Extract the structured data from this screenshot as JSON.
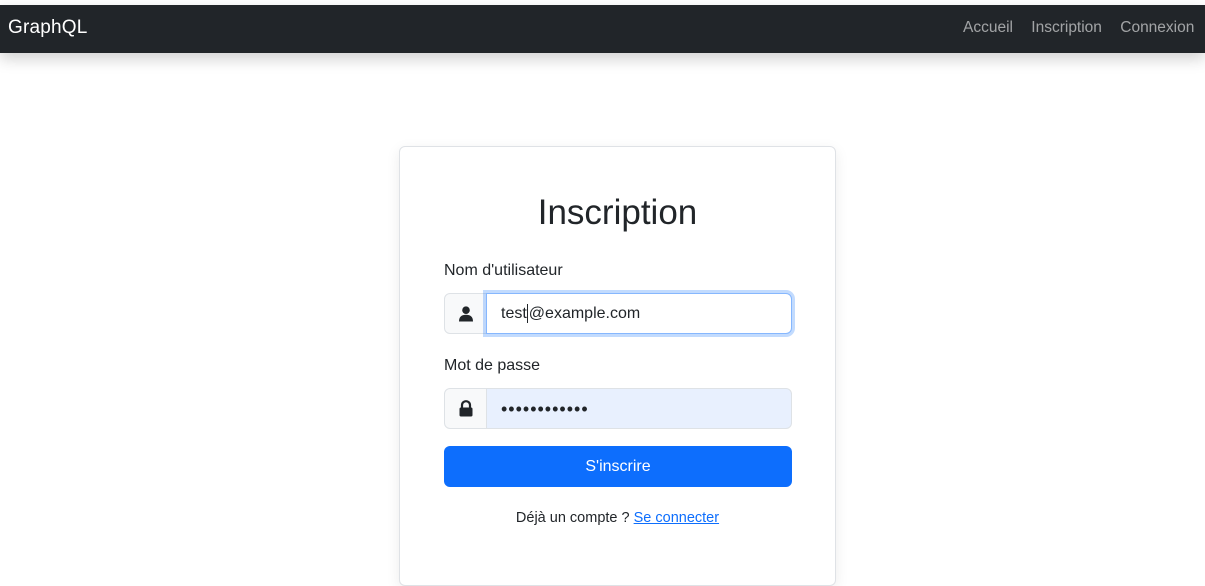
{
  "navbar": {
    "brand": "GraphQL",
    "links": [
      "Accueil",
      "Inscription",
      "Connexion"
    ]
  },
  "form": {
    "title": "Inscription",
    "username": {
      "label": "Nom d'utilisateur",
      "value_before_caret": "test",
      "value_after_caret": "@example.com",
      "icon": "user-icon"
    },
    "password": {
      "label": "Mot de passe",
      "masked_value": "••••••••••••",
      "icon": "lock-icon"
    },
    "submit_label": "S'inscrire",
    "footer_text": "Déjà un compte ? ",
    "footer_link": "Se connecter"
  },
  "colors": {
    "navbar_bg": "#212529",
    "primary": "#0d6efd",
    "autofill_bg": "#e8f0fe"
  }
}
